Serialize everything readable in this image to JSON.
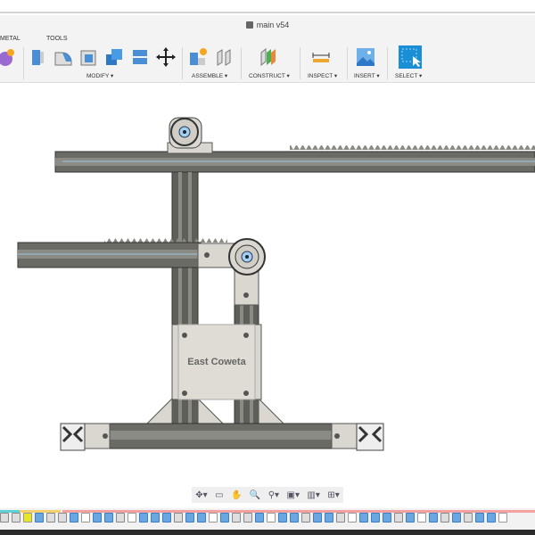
{
  "window": {
    "title": "main v54"
  },
  "ribbon": {
    "tabs": [
      "METAL",
      "TOOLS"
    ],
    "groups": [
      {
        "label": "MODIFY ▾"
      },
      {
        "label": "ASSEMBLE ▾"
      },
      {
        "label": "CONSTRUCT ▾"
      },
      {
        "label": "INSPECT ▾"
      },
      {
        "label": "INSERT ▾"
      },
      {
        "label": "SELECT ▾"
      }
    ]
  },
  "model": {
    "plate_text": "East Coweta"
  },
  "navbar": {
    "icons": [
      "orbit-icon",
      "look-at-icon",
      "pan-icon",
      "zoom-window-icon",
      "zoom-icon",
      "display-settings-icon",
      "grid-icon",
      "viewports-icon"
    ],
    "glyphs": [
      "✥▾",
      "▭",
      "✋",
      "🔍",
      "⚲▾",
      "▣▾",
      "▥▾",
      "⊞▾"
    ]
  },
  "colors": {
    "accent": "#1a8fd6",
    "rail": "#6b6b66",
    "plate": "#d9d7d0",
    "timeline_red": "#f2a0a0",
    "timeline_cyan": "#5fd0d8",
    "timeline_yellow": "#f5d070"
  }
}
